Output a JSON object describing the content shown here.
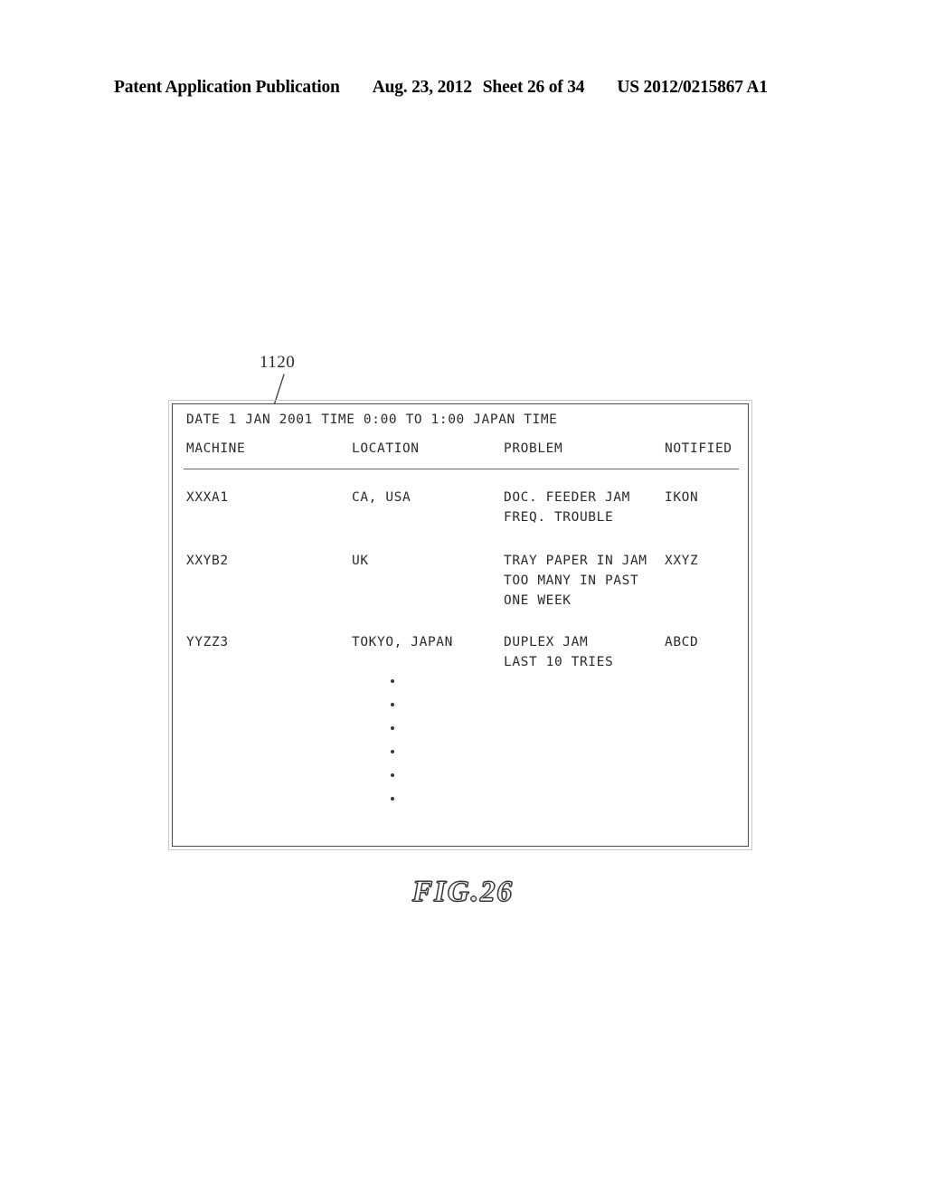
{
  "page_header": {
    "publication": "Patent Application Publication",
    "date": "Aug. 23, 2012",
    "sheet": "Sheet 26 of 34",
    "patent_number": "US 2012/0215867 A1"
  },
  "reference_numeral": "1120",
  "figure_caption": "FIG.26",
  "report": {
    "title_line": "DATE 1 JAN 2001 TIME 0:00 TO 1:00 JAPAN TIME",
    "columns": {
      "machine": "MACHINE",
      "location": "LOCATION",
      "problem": "PROBLEM",
      "notified": "NOTIFIED"
    },
    "rows": [
      {
        "machine": "XXXA1",
        "location": "CA, USA",
        "problem_line_1": "DOC. FEEDER JAM",
        "problem_line_2": "FREQ. TROUBLE",
        "problem_line_3": "",
        "notified": "IKON"
      },
      {
        "machine": "XXYB2",
        "location": "UK",
        "problem_line_1": "TRAY PAPER IN JAM",
        "problem_line_2": "TOO MANY IN PAST",
        "problem_line_3": "ONE WEEK",
        "notified": "XXYZ"
      },
      {
        "machine": "YYZZ3",
        "location": "TOKYO, JAPAN",
        "problem_line_1": "DUPLEX JAM",
        "problem_line_2": "LAST 10 TRIES",
        "problem_line_3": "",
        "notified": "ABCD"
      }
    ],
    "continuation_dots": 6
  },
  "colors": {
    "ink": "#2b2b2b",
    "border": "#4a4a4a",
    "page_background": "#ffffff"
  }
}
